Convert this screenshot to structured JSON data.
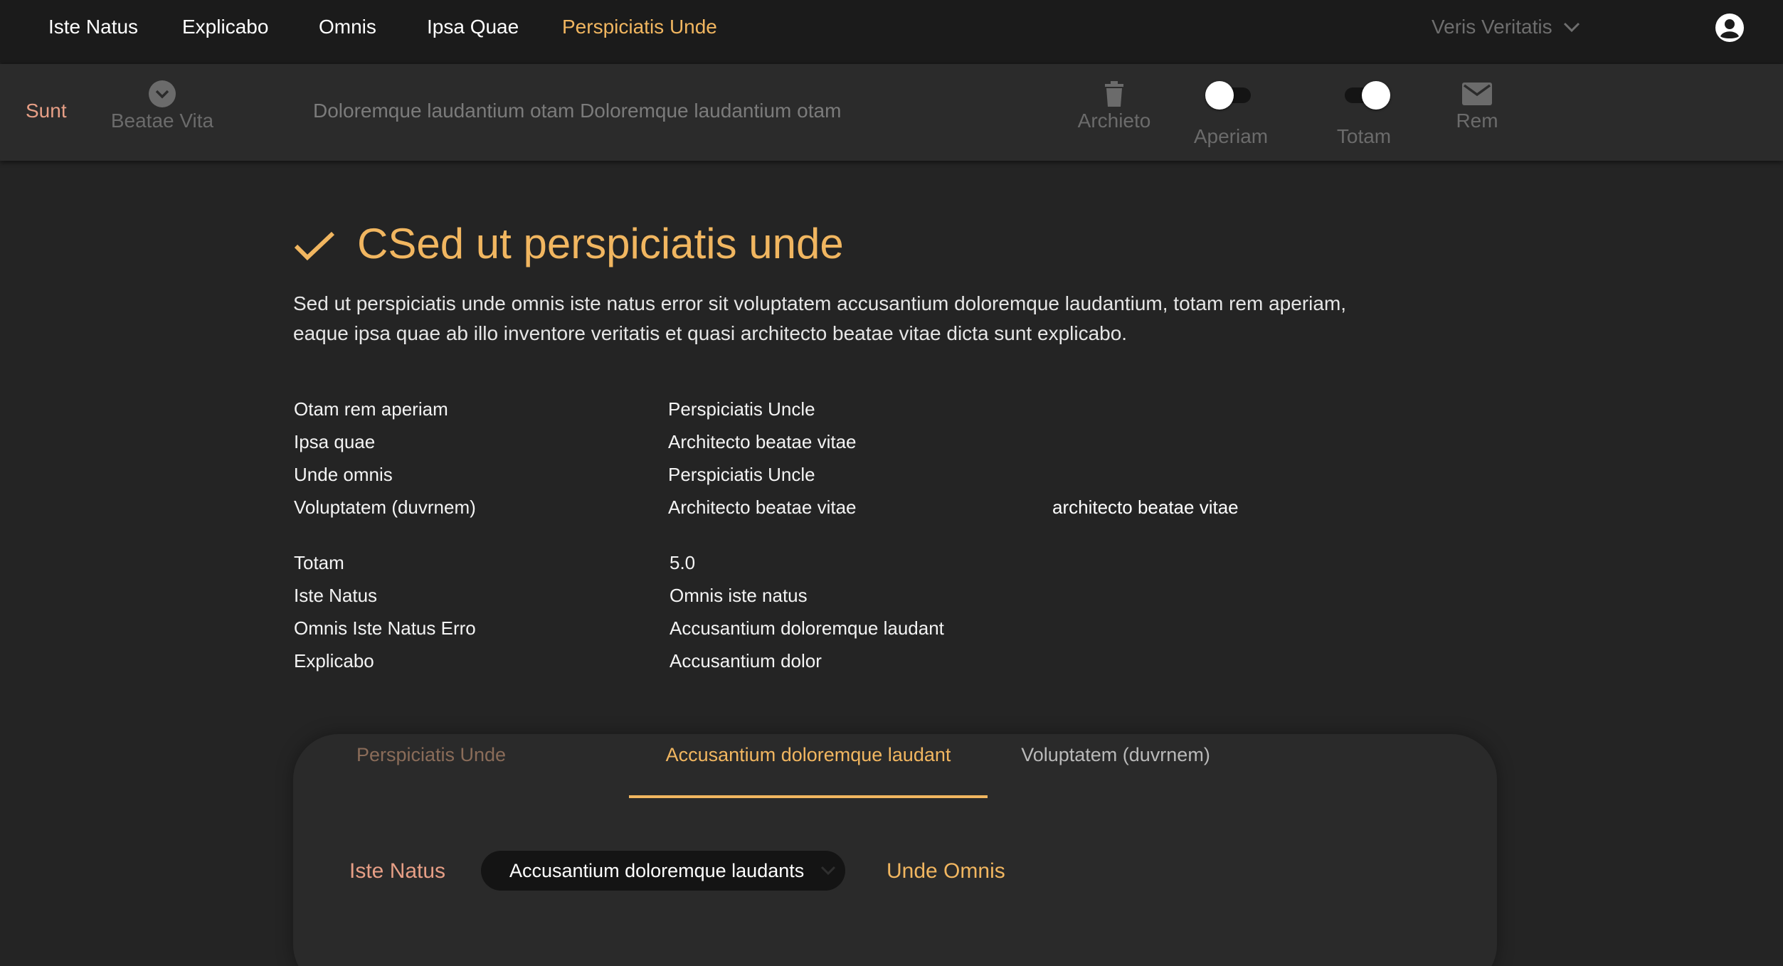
{
  "nav": {
    "links": [
      "Iste Natus",
      "Explicabo",
      "Omnis",
      "Ipsa Quae",
      "Perspiciatis Unde"
    ],
    "active_index": 4,
    "user_menu_label": "Veris Veritatis"
  },
  "toolbar": {
    "primary_label": "Sunt",
    "dropdown_label": "Beatae Vita",
    "breadcrumb": "Doloremque laudantium otam Doloremque laudantium otam",
    "archive_label": "Archieto",
    "toggle1": {
      "label": "Aperiam",
      "on": false
    },
    "toggle2": {
      "label": "Totam",
      "on": true
    },
    "mail_label": "Rem"
  },
  "main": {
    "title": "CSed ut perspiciatis unde",
    "description": "Sed ut perspiciatis unde omnis iste natus error sit voluptatem accusantium doloremque laudantium, totam rem aperiam, eaque ipsa quae ab illo inventore veritatis et quasi architecto beatae vitae dicta sunt explicabo.",
    "details_group1": [
      {
        "key": "Otam rem aperiam",
        "value": "Perspiciatis Uncle",
        "extra": ""
      },
      {
        "key": "Ipsa quae",
        "value": "Architecto beatae vitae",
        "extra": ""
      },
      {
        "key": "Unde omnis",
        "value": "Perspiciatis Uncle",
        "extra": ""
      },
      {
        "key": "Voluptatem (duvrnem)",
        "value": "Architecto beatae vitae",
        "extra": "architecto beatae vitae"
      }
    ],
    "details_group2": [
      {
        "key": "Totam",
        "value": "5.0"
      },
      {
        "key": "Iste Natus",
        "value": "Omnis iste natus"
      },
      {
        "key": "Omnis Iste Natus Erro",
        "value": "Accusantium doloremque laudant"
      },
      {
        "key": "Explicabo",
        "value": "Accusantium dolor"
      }
    ]
  },
  "card": {
    "tabs": [
      "Perspiciatis Unde",
      "Accusantium doloremque laudant",
      "Voluptatem (duvrnem)"
    ],
    "active_tab": 1,
    "field_label": "Iste Natus",
    "select_value": "Accusantium doloremque laudants",
    "link_label": "Unde Omnis"
  },
  "colors": {
    "accent": "#f1b660",
    "accent_soft": "#e79f86",
    "background": "#242424",
    "nav_background": "#1b1b1b"
  },
  "icons": [
    "check-icon",
    "chevron-down-icon",
    "account-circle-icon",
    "trash-icon",
    "mail-icon",
    "chevron-circle-icon"
  ]
}
